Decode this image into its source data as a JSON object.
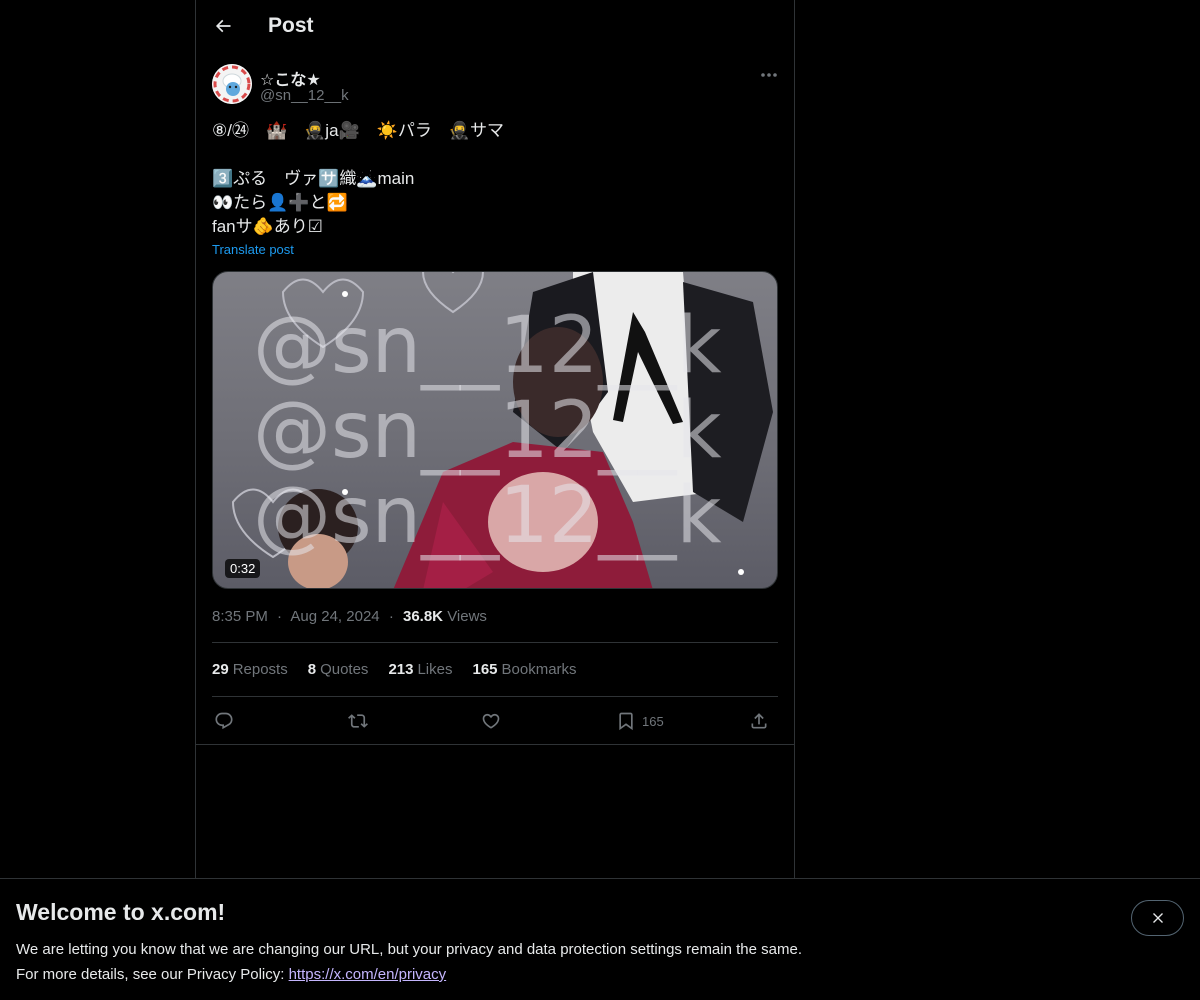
{
  "header": {
    "title": "Post",
    "back_icon": "arrow-left-icon"
  },
  "author": {
    "display_name": "☆こな★",
    "handle": "@sn__12__k"
  },
  "post": {
    "text": "⑧/㉔　🏰　🥷ja🎥　☀️パラ　🥷サマ\n\n3️⃣ぷる　ヴァ🈂️織🗻main\n👀たら👤➕と🔁\nfanサ🫵あり☑",
    "translate_label": "Translate post"
  },
  "media": {
    "duration": "0:32",
    "watermark": "@sn__12__k"
  },
  "meta": {
    "time": "8:35 PM",
    "date": "Aug 24, 2024",
    "views_count": "36.8K",
    "views_label": "Views",
    "separator": "·"
  },
  "stats": {
    "reposts_count": "29",
    "reposts_label": "Reposts",
    "quotes_count": "8",
    "quotes_label": "Quotes",
    "likes_count": "213",
    "likes_label": "Likes",
    "bookmarks_count": "165",
    "bookmarks_label": "Bookmarks"
  },
  "actions": {
    "reply_icon": "reply-icon",
    "repost_icon": "repost-icon",
    "like_icon": "heart-icon",
    "bookmark_icon": "bookmark-icon",
    "bookmark_count": "165",
    "share_icon": "share-icon"
  },
  "banner": {
    "title": "Welcome to x.com!",
    "line1": "We are letting you know that we are changing our URL, but your privacy and data protection settings remain the same.",
    "line2_prefix": "For more details, see our Privacy Policy: ",
    "link_text": "https://x.com/en/privacy",
    "close_icon": "close-icon"
  },
  "colors": {
    "background": "#000000",
    "text": "#e7e9ea",
    "muted": "#71767b",
    "accent": "#1d9bf0",
    "border": "#2f3336"
  }
}
